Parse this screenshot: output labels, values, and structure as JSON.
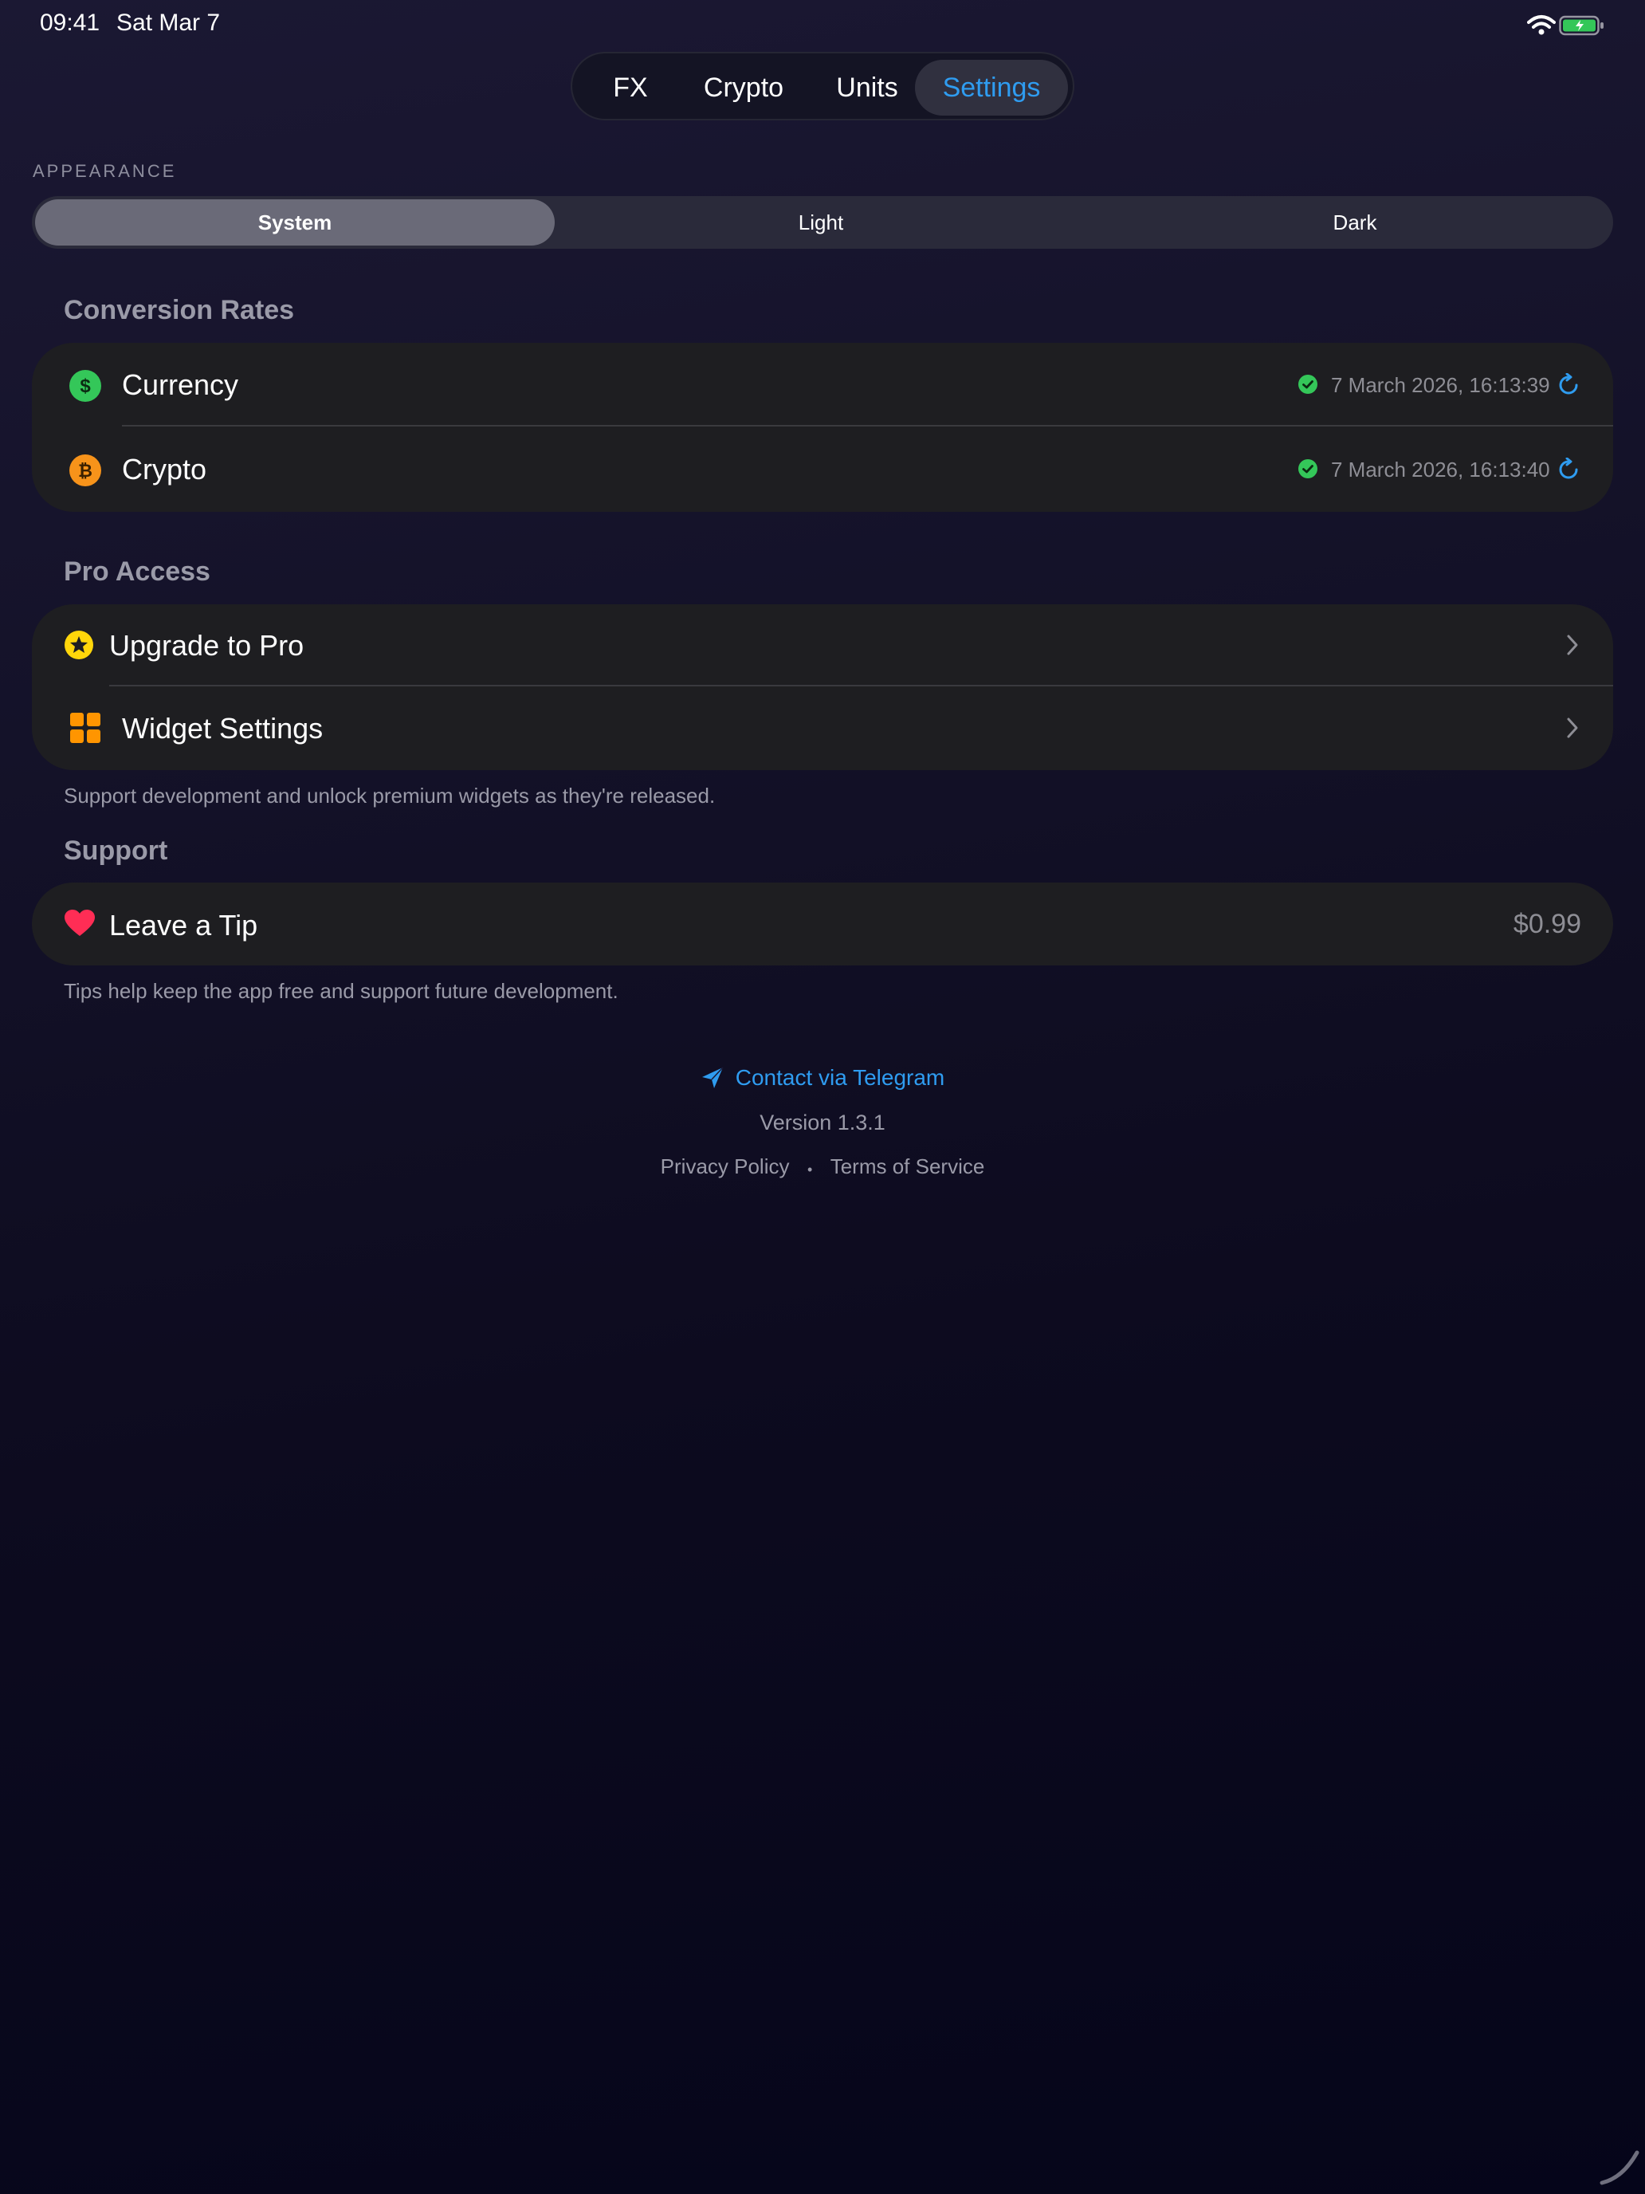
{
  "status_bar": {
    "time": "09:41",
    "date": "Sat Mar 7"
  },
  "tabs": [
    {
      "label": "FX",
      "active": false
    },
    {
      "label": "Crypto",
      "active": false
    },
    {
      "label": "Units",
      "active": false
    },
    {
      "label": "Settings",
      "active": true
    }
  ],
  "appearance": {
    "caption": "APPEARANCE",
    "options": [
      "System",
      "Light",
      "Dark"
    ],
    "selected": "System"
  },
  "conversion_rates": {
    "title": "Conversion Rates",
    "rows": [
      {
        "label": "Currency",
        "icon": "dollar-icon",
        "updated": "7 March 2026, 16:13:39"
      },
      {
        "label": "Crypto",
        "icon": "bitcoin-icon",
        "updated": "7 March 2026, 16:13:40"
      }
    ]
  },
  "pro_access": {
    "title": "Pro Access",
    "rows": [
      {
        "label": "Upgrade to Pro",
        "icon": "star-icon"
      },
      {
        "label": "Widget Settings",
        "icon": "grid-icon"
      }
    ],
    "footnote": "Support development and unlock premium widgets as they're released."
  },
  "support": {
    "title": "Support",
    "tip_label": "Leave a Tip",
    "tip_price": "$0.99",
    "footnote": "Tips help keep the app free and support future development."
  },
  "footer": {
    "contact": "Contact via Telegram",
    "version": "Version 1.3.1",
    "privacy": "Privacy Policy",
    "separator": "•",
    "terms": "Terms of Service"
  },
  "colors": {
    "accent": "#2f9cf0",
    "success": "#34c759",
    "currency_icon": "#34c759",
    "crypto_icon": "#f7931a",
    "star": "#ffd60a",
    "widget": "#ff9500",
    "heart": "#ff2d55"
  }
}
